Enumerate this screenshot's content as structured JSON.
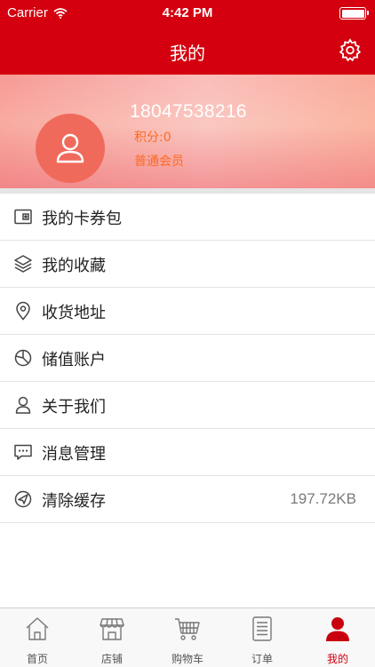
{
  "status_bar": {
    "carrier": "Carrier",
    "time": "4:42 PM"
  },
  "nav": {
    "title": "我的",
    "settings_icon": "gear-icon"
  },
  "profile": {
    "phone": "18047538216",
    "points": "积分:0",
    "level": "普通会员",
    "avatar_icon": "user-icon"
  },
  "menu": [
    {
      "label": "我的卡券包",
      "icon": "wallet-icon"
    },
    {
      "label": "我的收藏",
      "icon": "layers-icon"
    },
    {
      "label": "收货地址",
      "icon": "location-pin-icon"
    },
    {
      "label": "储值账户",
      "icon": "pie-chart-icon"
    },
    {
      "label": "关于我们",
      "icon": "user-outline-icon"
    },
    {
      "label": "消息管理",
      "icon": "chat-bubble-icon"
    },
    {
      "label": "清除缓存",
      "icon": "paper-plane-icon",
      "value": "197.72KB"
    }
  ],
  "tabs": [
    {
      "label": "首页",
      "icon": "home-icon"
    },
    {
      "label": "店铺",
      "icon": "store-icon"
    },
    {
      "label": "购物车",
      "icon": "cart-icon"
    },
    {
      "label": "订单",
      "icon": "order-list-icon"
    },
    {
      "label": "我的",
      "icon": "profile-icon",
      "active": true
    }
  ],
  "colors": {
    "brand": "#d4000f",
    "accent_orange": "#ff6a1f",
    "avatar_bg": "#f06a5c"
  }
}
